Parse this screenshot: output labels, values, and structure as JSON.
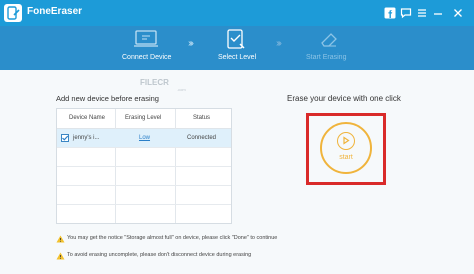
{
  "app": {
    "title": "FoneEraser"
  },
  "titlebar": {
    "icons": [
      "facebook-icon",
      "chat-icon",
      "menu-icon",
      "minimize-icon",
      "close-icon"
    ]
  },
  "steps": [
    {
      "label": "Connect Device",
      "icon": "device-icon",
      "state": "done"
    },
    {
      "label": "Select Level",
      "icon": "checklist-icon",
      "state": "current"
    },
    {
      "label": "Start Erasing",
      "icon": "eraser-icon",
      "state": "pending"
    }
  ],
  "left_panel": {
    "title": "Add new device before erasing",
    "columns": [
      "Device Name",
      "Erasing Level",
      "Status"
    ],
    "rows": [
      {
        "checked": true,
        "device": "jenny's i...",
        "level": "Low",
        "status": "Connected"
      }
    ]
  },
  "right_panel": {
    "title": "Erase your device with one click",
    "start_label": "start"
  },
  "watermark": {
    "text": "FILECR",
    "sub": ".com"
  },
  "notices": [
    "You may get the notice \"Storage almost full\" on device, please click \"Done\" to continue",
    "To avoid erasing uncomplete, please don't disconnect device during erasing"
  ],
  "colors": {
    "titlebar": "#1d9bd8",
    "steps_bar": "#2b8ecb",
    "accent": "#f0b43c",
    "highlight": "#d92a2a"
  }
}
